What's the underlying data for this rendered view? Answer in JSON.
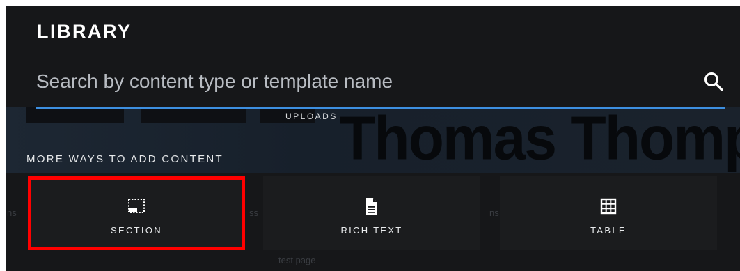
{
  "library": {
    "title": "LIBRARY",
    "search": {
      "placeholder": "Search by content type or template name",
      "value": ""
    },
    "uploads_label": "UPLOADS",
    "more_ways_label": "MORE WAYS TO ADD CONTENT",
    "options": [
      {
        "label": "SECTION",
        "icon": "section-icon",
        "selected": true
      },
      {
        "label": "RICH TEXT",
        "icon": "document-icon",
        "selected": false
      },
      {
        "label": "TABLE",
        "icon": "table-icon",
        "selected": false
      }
    ]
  },
  "background": {
    "name_text": "Thomas Thompson",
    "snippets": [
      "ns",
      "ss",
      "ns",
      "test page"
    ]
  },
  "colors": {
    "panel": "#161719",
    "card": "#1b1c1e",
    "accent": "#3d8fe0",
    "highlight": "#ff0000",
    "text": "#ffffff"
  }
}
